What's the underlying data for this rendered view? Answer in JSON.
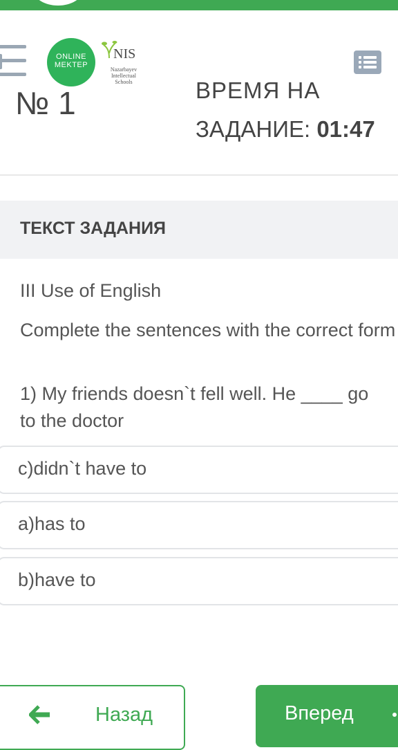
{
  "header": {
    "logo_online_line1": "ONLINE",
    "logo_online_line2": "MEKTEP",
    "logo_nis_text": "NIS",
    "logo_nis_sub_line1": "Nazarbayev",
    "logo_nis_sub_line2": "Intellectual",
    "logo_nis_sub_line3": "Schools"
  },
  "task": {
    "number_label": "№ 1",
    "time_label_line1": "ВРЕМЯ НА",
    "time_label_line2": "ЗАДАНИЕ:",
    "time_value": "01:47"
  },
  "section": {
    "title": "ТЕКСТ ЗАДАНИЯ"
  },
  "question": {
    "part": "III Use of English",
    "instruction": "Complete the sentences with the correct form :",
    "sentence_line1": "1) My friends doesn`t fell well. He ____ go",
    "sentence_line2": "to the doctor"
  },
  "options": [
    {
      "label": "c)didn`t have to"
    },
    {
      "label": "a)has to"
    },
    {
      "label": "b)have to"
    }
  ],
  "nav": {
    "back_label": "Назад",
    "next_label": "Вперед"
  },
  "colors": {
    "accent_green": "#3fa953",
    "logo_green": "#2fb35a",
    "section_bg": "#f1f2f4"
  }
}
